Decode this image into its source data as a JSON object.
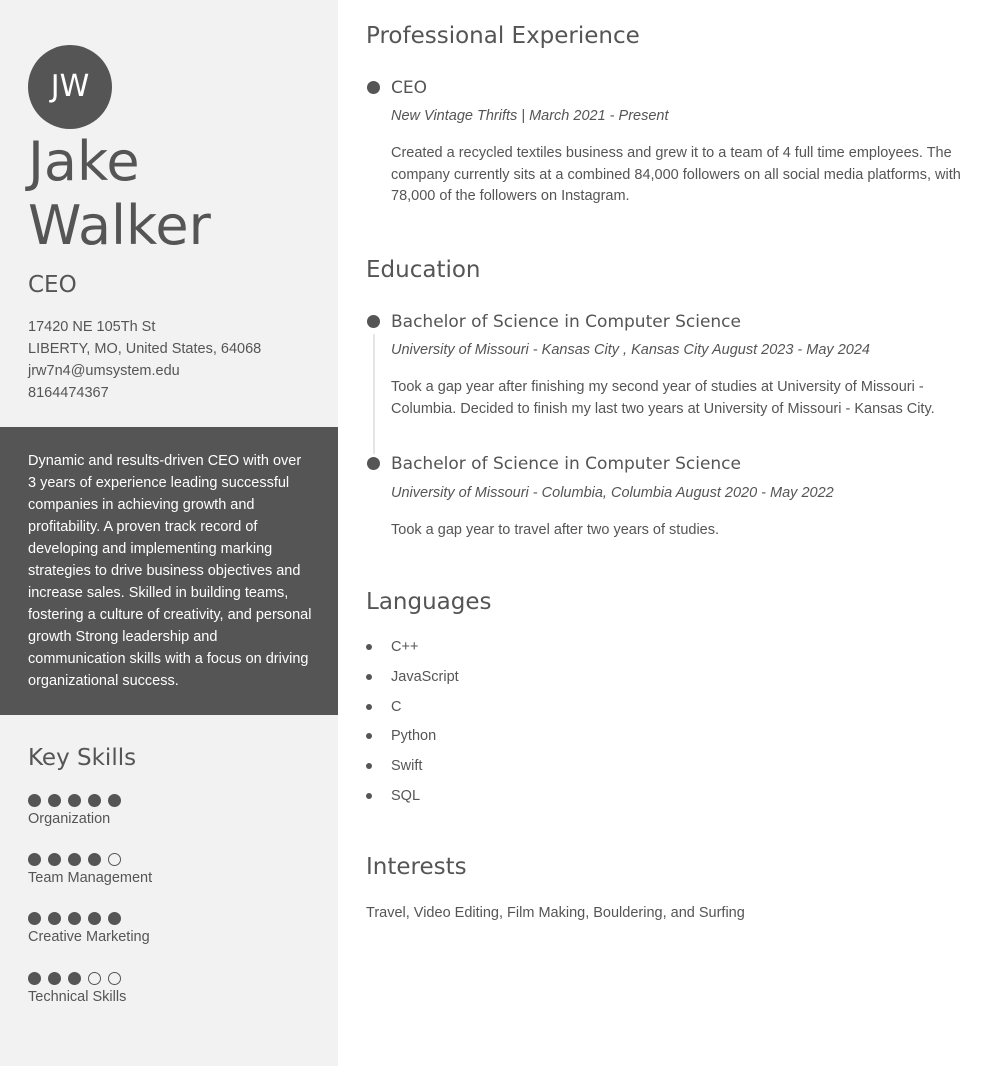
{
  "profile": {
    "initials": "JW",
    "first_name": "Jake",
    "last_name": "Walker",
    "title": "CEO",
    "address_line1": "17420 NE 105Th St",
    "address_line2": "LIBERTY, MO, United States, 64068",
    "email": "jrw7n4@umsystem.edu",
    "phone": "8164474367"
  },
  "summary": "Dynamic and results-driven CEO with over 3 years of experience leading successful companies in achieving growth and profitability. A proven track record of developing and implementing marking strategies to drive business objectives and increase sales. Skilled in building teams, fostering a culture of creativity, and personal growth Strong leadership and communication skills with a focus on driving organizational success.",
  "skills": {
    "heading": "Key Skills",
    "items": [
      {
        "label": "Organization",
        "rating": 5,
        "max": 5
      },
      {
        "label": "Team Management",
        "rating": 4,
        "max": 5
      },
      {
        "label": "Creative Marketing",
        "rating": 5,
        "max": 5
      },
      {
        "label": "Technical Skills",
        "rating": 3,
        "max": 5
      }
    ]
  },
  "experience": {
    "heading": "Professional Experience",
    "items": [
      {
        "title": "CEO",
        "subtitle": "New Vintage Thrifts | March 2021 - Present",
        "description": "Created a recycled textiles business and grew it to a team of 4 full time employees. The company currently sits at a combined 84,000 followers on all social media platforms, with 78,000 of the followers on Instagram."
      }
    ]
  },
  "education": {
    "heading": "Education",
    "items": [
      {
        "title": "Bachelor of Science in Computer Science",
        "subtitle": "University of Missouri - Kansas City , Kansas City August 2023 - May 2024",
        "description": "Took a gap year after finishing my second year of studies at University of Missouri - Columbia. Decided to finish my last two years at University of Missouri - Kansas City."
      },
      {
        "title": "Bachelor of Science in Computer Science",
        "subtitle": "University of Missouri - Columbia, Columbia August 2020 - May 2022",
        "description": "Took a gap year to travel after two years of studies."
      }
    ]
  },
  "languages": {
    "heading": "Languages",
    "items": [
      "C++",
      "JavaScript",
      "C",
      "Python",
      "Swift",
      "SQL"
    ]
  },
  "interests": {
    "heading": "Interests",
    "text": "Travel, Video Editing, Film Making, Bouldering, and Surfing"
  }
}
